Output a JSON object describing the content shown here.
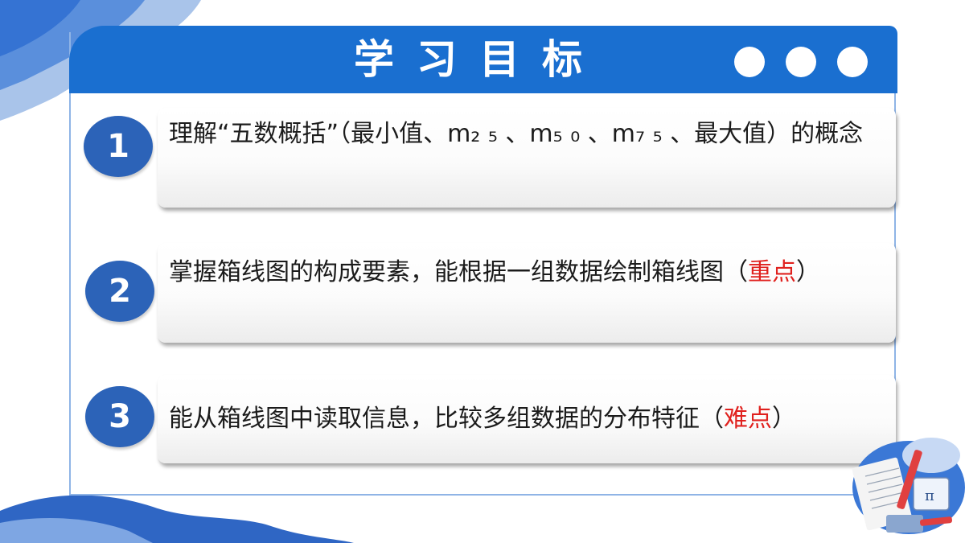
{
  "header": {
    "title": "学习目标",
    "accent_color": "#1a6fd0"
  },
  "objectives": [
    {
      "number": "1",
      "text": "理解“五数概括”（最小值、m₂ ₅ 、m₅ ₀ 、m₇ ₅ 、最大值）的概念"
    },
    {
      "number": "2",
      "text": "掌握箱线图的构成要素，能根据一组数据绘制箱线图（",
      "highlight": "重点",
      "suffix": "）"
    },
    {
      "number": "3",
      "text": "能从箱线图中读取信息，比较多组数据的分布特征（",
      "highlight": "难点",
      "suffix": "）"
    }
  ],
  "highlight_color": "#e0211e",
  "icons": [
    "math-study-clipart"
  ]
}
